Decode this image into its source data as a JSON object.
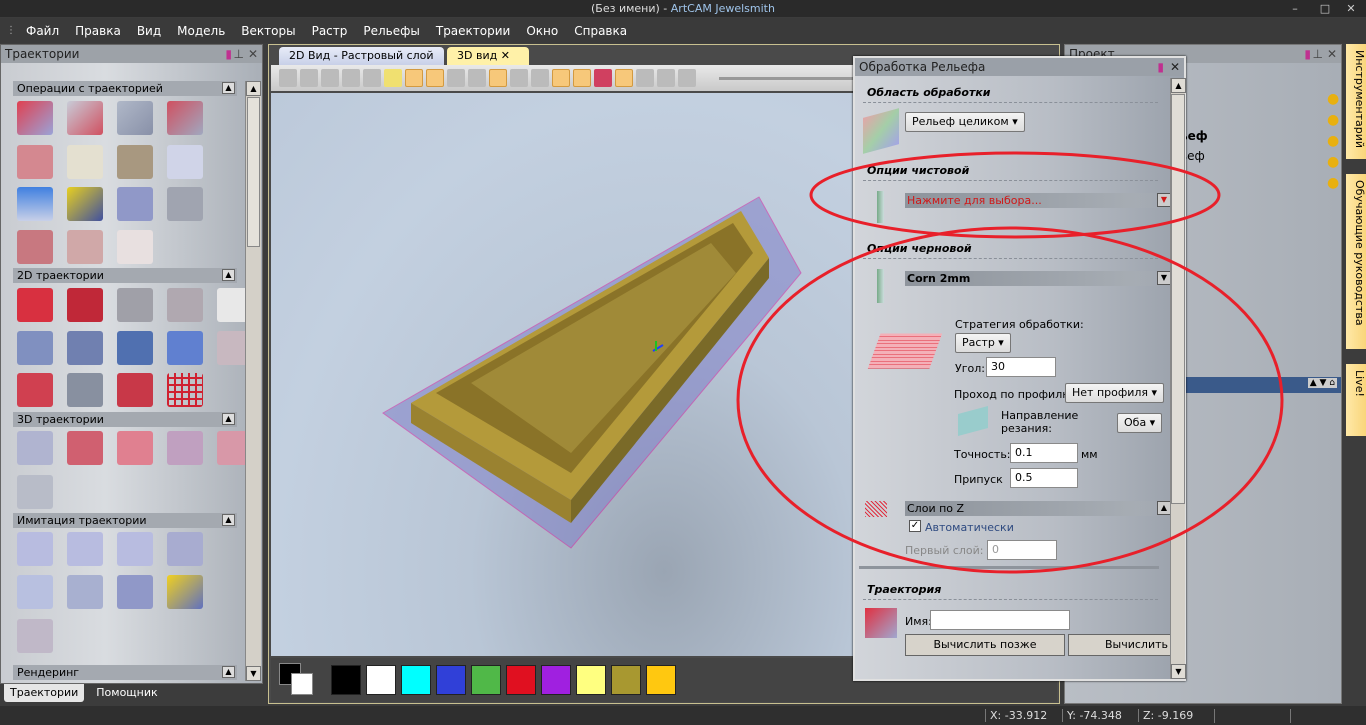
{
  "window": {
    "title_doc": "(Без имени) - ",
    "title_app": "ArtCAM Jewelsmith"
  },
  "menu": [
    "Файл",
    "Правка",
    "Вид",
    "Модель",
    "Векторы",
    "Растр",
    "Рельефы",
    "Траектории",
    "Окно",
    "Справка"
  ],
  "left_panel": {
    "title": "Траектории",
    "sections": [
      "Операции с траекторией",
      "2D траектории",
      "3D траектории",
      "Имитация траектории",
      "Рендеринг"
    ],
    "bottom_tabs": [
      "Траектории",
      "Помощник"
    ]
  },
  "doc_tabs": [
    "2D Вид - Растровый слой",
    "3D вид"
  ],
  "palette": {
    "colors": [
      "#000000",
      "#ffffff",
      "#00ffff",
      "#3040d8",
      "#50b848",
      "#e01020",
      "#a020e0",
      "#ffff80",
      "#a89830",
      "#ffc810"
    ]
  },
  "dialog": {
    "title": "Обработка Рельефа",
    "area_section": "Область обработки",
    "area_value": "Рельеф целиком",
    "finish_section": "Опции чистовой",
    "finish_tool": "Нажмите для выбора...",
    "rough_section": "Опции черновой",
    "rough_tool": "Corn 2mm",
    "strategy_label": "Стратегия обработки:",
    "strategy_value": "Растр",
    "angle_label": "Угол:",
    "angle_value": "30",
    "profile_label": "Проход по профилю:",
    "profile_value": "Нет профиля",
    "direction_label_1": "Направление",
    "direction_label_2": "резания:",
    "direction_value": "Оба",
    "tolerance_label": "Точность:",
    "tolerance_value": "0.1",
    "tolerance_unit": "мм",
    "allowance_label": "Припуск",
    "allowance_value": "0.5",
    "zlayers_label": "Слои по Z",
    "auto_label": "Автоматически",
    "auto_checked": true,
    "first_layer_label": "Первый слой:",
    "first_layer_value": "0",
    "toolpath_section": "Траектория",
    "name_label": "Имя:",
    "name_value": "",
    "calc_later": "Вычислить позже",
    "calc_now": "Вычислить се"
  },
  "project": {
    "title": "Проект",
    "line1": "ьеф",
    "line2": "ьеф"
  },
  "right_tabs": [
    "Инструментарий",
    "Обучающие руководства",
    "Live!"
  ],
  "status": {
    "x": "X: -33.912",
    "y": "Y: -74.348",
    "z": "Z: -9.169"
  }
}
